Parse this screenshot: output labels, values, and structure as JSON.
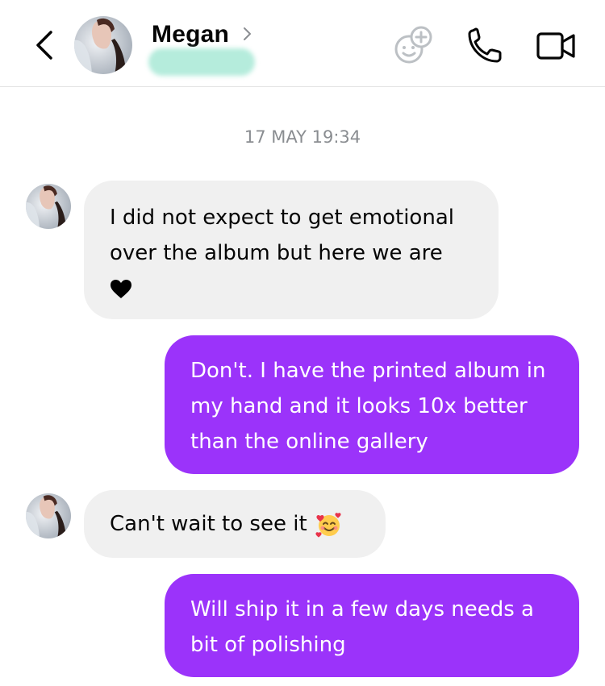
{
  "header": {
    "contact_name": "Megan",
    "icons": [
      "back-chevron-icon",
      "effects-icon",
      "phone-icon",
      "video-camera-icon"
    ]
  },
  "thread": {
    "timestamp": "17 MAY 19:34",
    "messages": [
      {
        "direction": "incoming",
        "lines": [
          "I did not expect to get emotional",
          "over the album but here we are"
        ],
        "trailing_icon": "black-heart-icon"
      },
      {
        "direction": "outgoing",
        "lines": [
          "Don't. I have the printed album in",
          "my hand and it looks 10x better",
          "than the online gallery"
        ]
      },
      {
        "direction": "incoming",
        "lines": [
          "Can't wait to see it"
        ],
        "trailing_icon": "smiling-face-with-hearts-icon"
      },
      {
        "direction": "outgoing",
        "lines": [
          "Will ship it in a few days needs a",
          "bit of polishing"
        ]
      }
    ]
  },
  "colors": {
    "outgoing_bubble": "#9b33fa",
    "incoming_bubble": "#f0f0f0",
    "status_blur": "#b5ecdc",
    "timestamp_text": "#8a8d91"
  }
}
